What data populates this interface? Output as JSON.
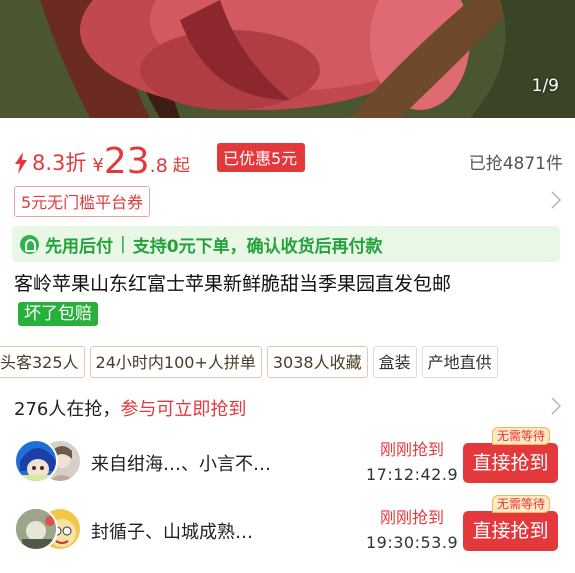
{
  "gallery": {
    "counter": "1/9"
  },
  "price": {
    "discount": "8.3折",
    "currency": "¥",
    "integer": "23",
    "decimal": ".8",
    "suffix": "起",
    "saved_badge": "已优惠5元",
    "sold": "已抢4871件"
  },
  "coupon": {
    "label": "5元无门槛平台券"
  },
  "payment": {
    "title": "先用后付",
    "sep": "|",
    "desc": "支持0元下单，确认收货后再付款"
  },
  "product": {
    "title": "客岭苹果山东红富士苹果新鲜脆甜当季果园直发包邮",
    "guarantee_tag": "坏了包赔"
  },
  "tags": [
    "头客325人",
    "24小时内100+人拼单",
    "3038人收藏",
    "盒装",
    "产地直供"
  ],
  "group": {
    "count_text": "276人在抢，",
    "cta_text": "参与可立即抢到",
    "rows": [
      {
        "names": "来自绀海…、小言不…",
        "status": "刚刚抢到",
        "time": "17:12:42.9",
        "button": "直接抢到",
        "button_tag": "无需等待"
      },
      {
        "names": "封循子、山城成熟…",
        "status": "刚刚抢到",
        "time": "19:30:53.9",
        "button": "直接抢到",
        "button_tag": "无需等待"
      }
    ]
  },
  "colors": {
    "accent": "#e4393c",
    "green": "#27b13b",
    "green_band": "#e8f7e6"
  },
  "icons": [
    "lightning-icon",
    "chevron-right-icon",
    "pay-later-icon"
  ]
}
